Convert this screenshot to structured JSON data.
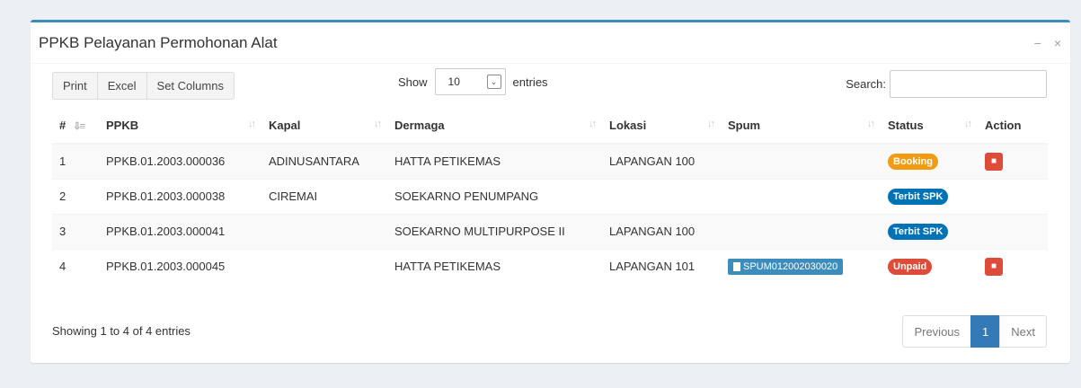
{
  "box": {
    "title": "PPKB Pelayanan Permohonan Alat",
    "minimize": "−",
    "close": "×"
  },
  "buttons": [
    "Print",
    "Excel",
    "Set Columns"
  ],
  "length": {
    "show": "Show",
    "value": "10",
    "entries": "entries"
  },
  "search": {
    "label": "Search:",
    "value": ""
  },
  "columns": [
    "#",
    "PPKB",
    "Kapal",
    "Dermaga",
    "Lokasi",
    "Spum",
    "Status",
    "Action"
  ],
  "rows": [
    {
      "no": "1",
      "ppkb": "PPKB.01.2003.000036",
      "kapal": "ADINUSANTARA",
      "dermaga": "HATTA PETIKEMAS",
      "lokasi": "LAPANGAN 100",
      "spum": "",
      "status": "Booking",
      "status_color": "#f39c12",
      "action": true
    },
    {
      "no": "2",
      "ppkb": "PPKB.01.2003.000038",
      "kapal": "CIREMAI",
      "dermaga": "SOEKARNO PENUMPANG",
      "lokasi": "",
      "spum": "",
      "status": "Terbit SPK",
      "status_color": "#0073b7",
      "action": false
    },
    {
      "no": "3",
      "ppkb": "PPKB.01.2003.000041",
      "kapal": "",
      "dermaga": "SOEKARNO MULTIPURPOSE II",
      "lokasi": "LAPANGAN 100",
      "spum": "",
      "status": "Terbit SPK",
      "status_color": "#0073b7",
      "action": false
    },
    {
      "no": "4",
      "ppkb": "PPKB.01.2003.000045",
      "kapal": "",
      "dermaga": "HATTA PETIKEMAS",
      "lokasi": "LAPANGAN 101",
      "spum": "SPUM012002030020",
      "status": "Unpaid",
      "status_color": "#dd4b39",
      "action": true
    }
  ],
  "info": "Showing 1 to 4 of 4 entries",
  "pager": {
    "previous": "Previous",
    "current": "1",
    "next": "Next"
  },
  "icons": {
    "sort": "sort-icon",
    "delete": "trash-icon",
    "file": "file-icon"
  }
}
